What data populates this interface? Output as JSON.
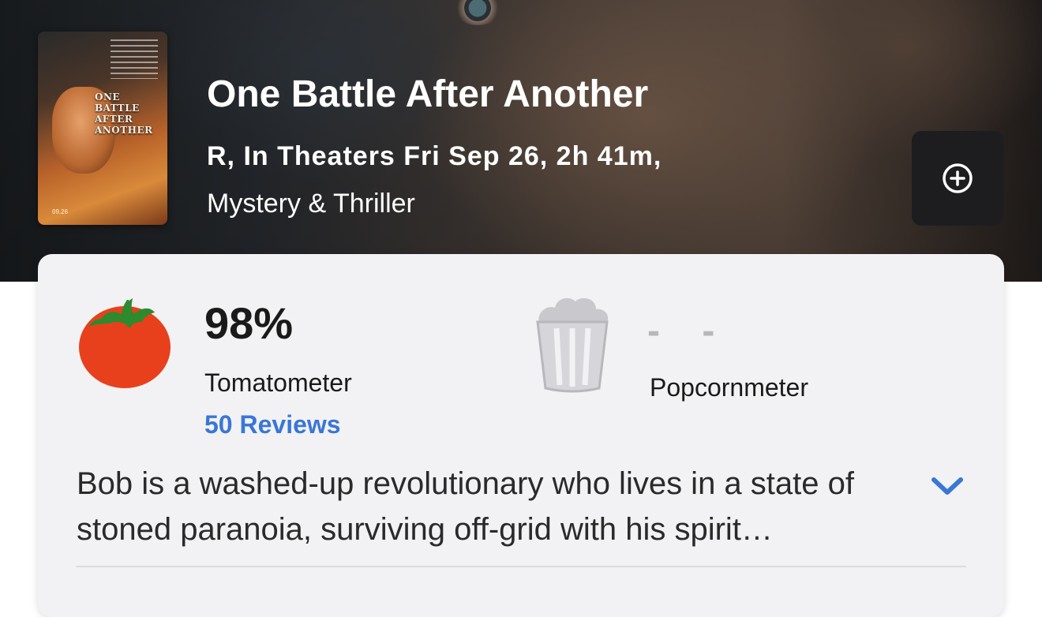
{
  "movie": {
    "title": "One Battle After Another",
    "meta_line": "R, In Theaters Fri Sep 26, 2h 41m,",
    "genre": "Mystery & Thriller",
    "poster": {
      "title_text": "One Battle After Another",
      "date_text": "09.26"
    }
  },
  "actions": {
    "add_icon": "plus-circle-icon"
  },
  "scores": {
    "tomatometer": {
      "value": "98%",
      "label": "Tomatometer",
      "reviews_link": "50 Reviews",
      "icon": "tomato-icon",
      "color": "#e8401c"
    },
    "popcornmeter": {
      "value": "- -",
      "label": "Popcornmeter",
      "icon": "popcorn-bucket-icon"
    }
  },
  "synopsis": {
    "text": "Bob is a washed-up revolutionary who lives in a state of stoned paranoia, surviving off-grid with his spirit…",
    "expand_icon": "chevron-down-icon"
  },
  "colors": {
    "link": "#3a76d6",
    "card_bg": "#f2f2f4",
    "button_bg": "#1d1d1f"
  }
}
